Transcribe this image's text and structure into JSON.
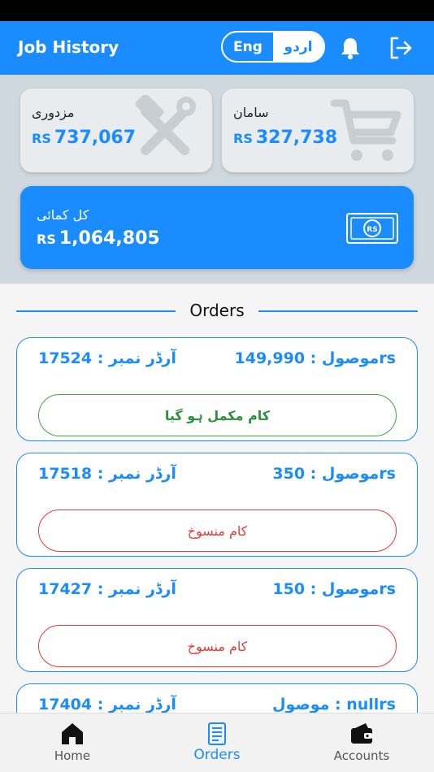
{
  "colors": {
    "primary": "#1a8cff",
    "done": "#3aa54a",
    "cancel": "#e53935"
  },
  "header": {
    "title": "Job History",
    "lang_eng": "Eng",
    "lang_urdu": "اردو",
    "bell_icon": "bell-icon",
    "logout_icon": "logout-icon"
  },
  "summary": {
    "labor": {
      "label": "مزدوری",
      "currency": "RS",
      "value": "737,067",
      "icon": "tools-icon"
    },
    "materials": {
      "label": "سامان",
      "currency": "RS",
      "value": "327,738",
      "icon": "cart-icon"
    },
    "total": {
      "label": "کل کمائی",
      "currency": "RS",
      "value": "1,064,805",
      "icon": "money-icon"
    }
  },
  "orders": {
    "heading": "Orders",
    "items": [
      {
        "id_label": "آرڈر نمبر : 17524",
        "amount_label": "موصول : 149,990rs",
        "status": "کام مکمل ہو گیا",
        "state": "done"
      },
      {
        "id_label": "آرڈر نمبر : 17518",
        "amount_label": "موصول : 350rs",
        "status": "کام منسوخ",
        "state": "cancel"
      },
      {
        "id_label": "آرڈر نمبر : 17427",
        "amount_label": "موصول : 150rs",
        "status": "کام منسوخ",
        "state": "cancel"
      },
      {
        "id_label": "آرڈر نمبر : 17404",
        "amount_label": "موصول : nullrs",
        "status": "",
        "state": ""
      }
    ]
  },
  "nav": {
    "home": "Home",
    "orders": "Orders",
    "accounts": "Accounts"
  }
}
